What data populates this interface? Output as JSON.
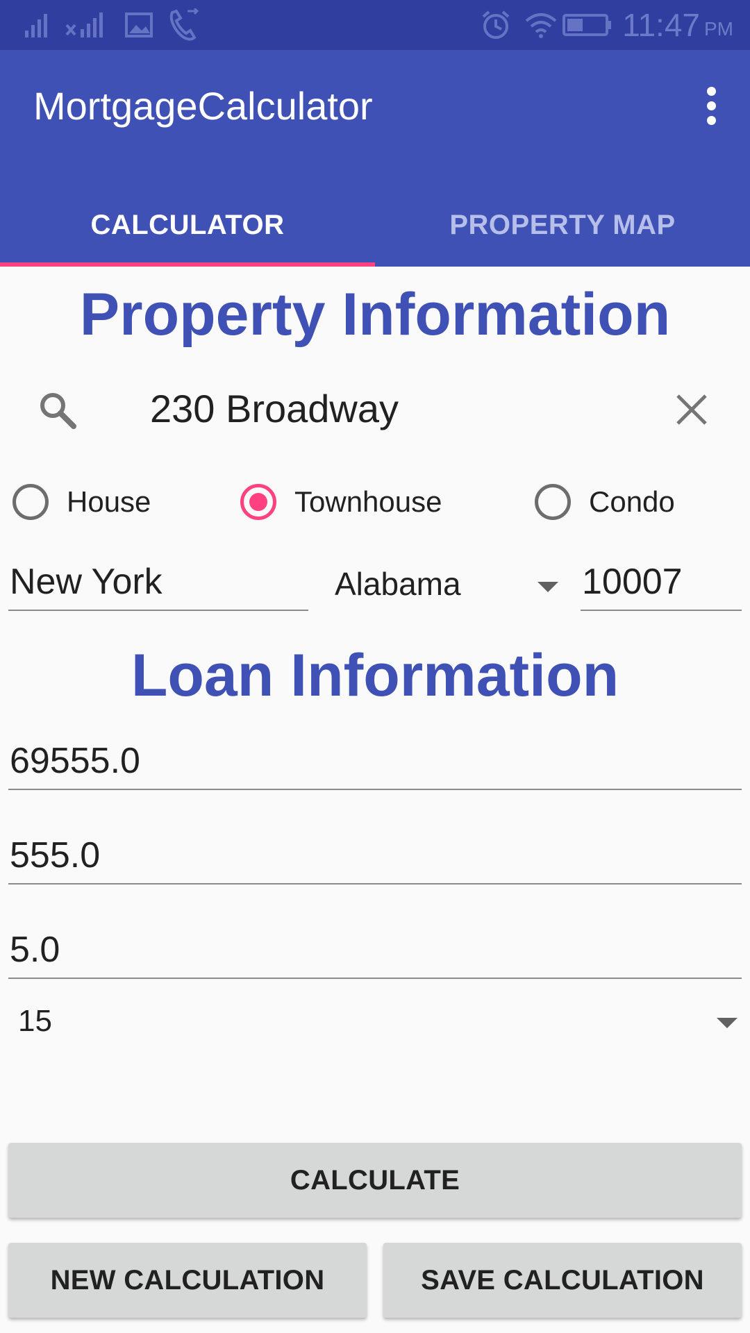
{
  "status_bar": {
    "time": "11:47",
    "ampm": "PM",
    "icons": [
      "signal-icon",
      "signal-x-icon",
      "image-icon",
      "call-icon",
      "alarm-icon",
      "wifi-icon",
      "battery-icon"
    ]
  },
  "app_bar": {
    "title": "MortgageCalculator",
    "overflow_icon": "more-vert-icon"
  },
  "tabs": [
    {
      "label": "CALCULATOR",
      "active": true
    },
    {
      "label": "PROPERTY MAP",
      "active": false
    }
  ],
  "property": {
    "heading": "Property Information",
    "search_value": "230 Broadway",
    "types": [
      {
        "label": "House",
        "checked": false
      },
      {
        "label": "Townhouse",
        "checked": true
      },
      {
        "label": "Condo",
        "checked": false
      }
    ],
    "city": "New York",
    "state": "Alabama",
    "zip": "10007"
  },
  "loan": {
    "heading": "Loan Information",
    "amount": "69555.0",
    "down_payment": "555.0",
    "rate": "5.0",
    "term": "15"
  },
  "buttons": {
    "calculate": "CALCULATE",
    "new_calculation": "NEW CALCULATION",
    "save_calculation": "SAVE CALCULATION"
  },
  "colors": {
    "primary": "#3f51b5",
    "primary_dark": "#303f9f",
    "accent": "#ff4081",
    "background": "#fafafa"
  }
}
